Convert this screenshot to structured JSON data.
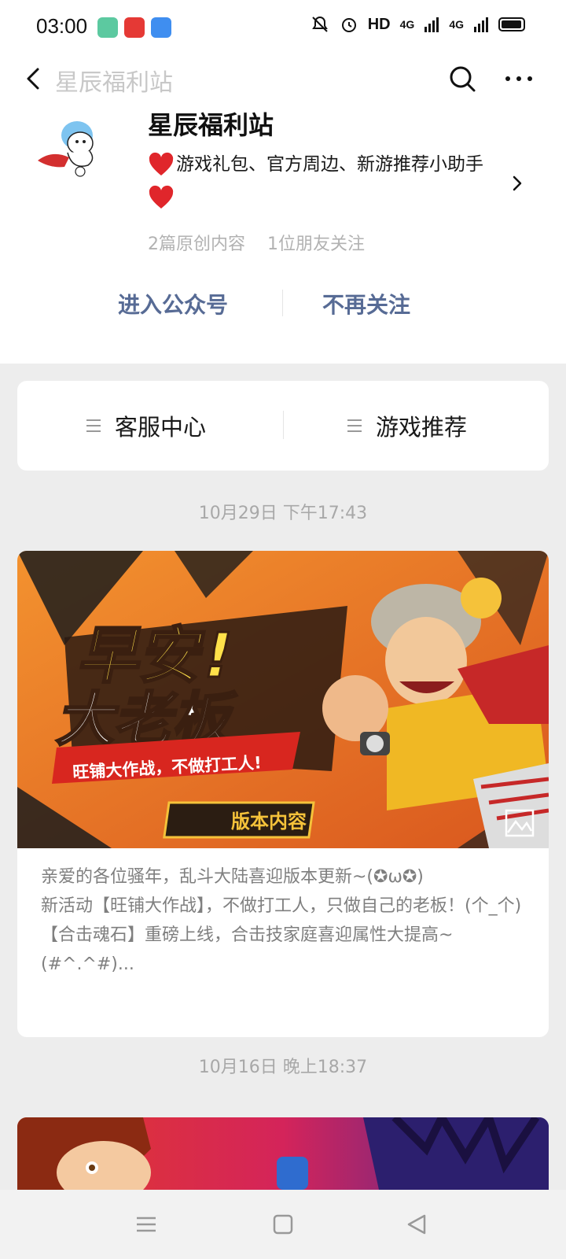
{
  "status_bar": {
    "time": "03:00",
    "network_label": "HD",
    "signal_1": "4G",
    "signal_2": "4G",
    "icons": [
      "app-notification-icon",
      "weibo-icon",
      "chat-icon",
      "mute-icon",
      "alarm-icon",
      "battery-icon"
    ]
  },
  "nav": {
    "title": "星辰福利站",
    "icons": [
      "back-icon",
      "search-icon",
      "more-icon"
    ]
  },
  "account": {
    "name": "星辰福利站",
    "description": "游戏礼包、官方周边、新游推荐小助手",
    "original_count": "2篇原创内容",
    "followers": "1位朋友关注",
    "enter_label": "进入公众号",
    "unfollow_label": "不再关注"
  },
  "menu": {
    "items": [
      {
        "label": "客服中心"
      },
      {
        "label": "游戏推荐"
      }
    ]
  },
  "articles": [
    {
      "date": "10月29日 下午17:43",
      "cover_title_1": "早安!",
      "cover_title_2": "大老板",
      "cover_subtitle": "旺铺大作战，不做打工人!",
      "cover_badge": "版本内容",
      "excerpt": [
        "亲爱的各位骚年，乱斗大陆喜迎版本更新~(✪ω✪)",
        "新活动【旺铺大作战】，不做打工人，只做自己的老板！(个_个)",
        "【合击魂石】重磅上线，合击技家庭喜迎属性大提高~(#^.^#)..."
      ]
    },
    {
      "date": "10月16日 晚上18:37"
    }
  ],
  "colors": {
    "link_blue": "#576b95",
    "background": "#ededed",
    "card": "#ffffff",
    "muted": "#a8a8a8",
    "cover_orange": "#e8742a"
  }
}
